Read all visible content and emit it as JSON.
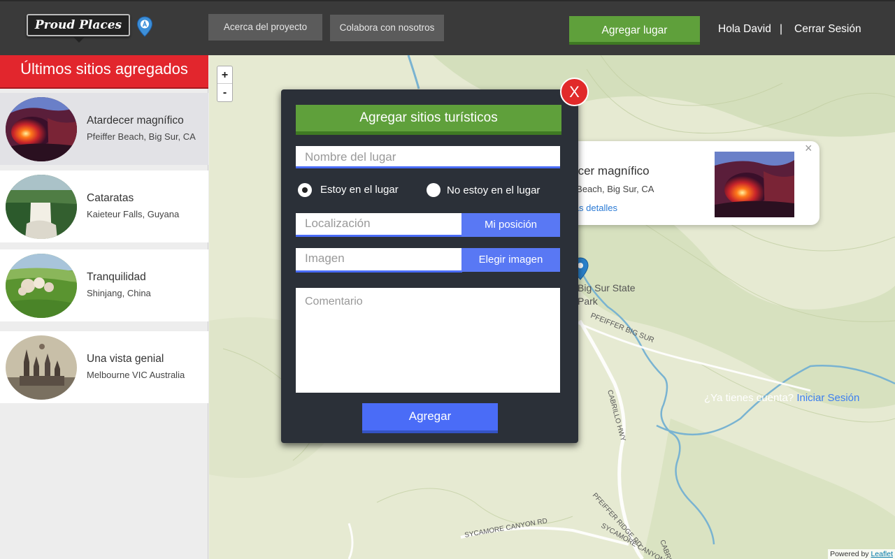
{
  "header": {
    "logo_text": "Proud Places",
    "nav_about": "Acerca del proyecto",
    "nav_collab": "Colabora con nosotros",
    "add_place": "Agregar lugar",
    "greeting": "Hola David",
    "separator": "|",
    "logout": "Cerrar Sesión"
  },
  "sidebar": {
    "title": "Últimos sitios agregados",
    "sites": [
      {
        "name": "Atardecer magnífico",
        "location": "Pfeiffer Beach, Big Sur, CA"
      },
      {
        "name": "Cataratas",
        "location": "Kaieteur Falls, Guyana"
      },
      {
        "name": "Tranquilidad",
        "location": "Shinjang, China"
      },
      {
        "name": "Una vista genial",
        "location": "Melbourne VIC Australia"
      }
    ]
  },
  "map": {
    "zoom_in": "+",
    "zoom_out": "-",
    "labels": {
      "park1": "Big Sur State",
      "park2": "Park",
      "road_pfeiffer_big_sur": "PFEIFFER BIG SUR",
      "road_cabrillo": "CABRILLO HWY",
      "road_pfeiffer_ridge": "PFEIFFER RIDGE RD",
      "road_sycamore1": "SYCAMORE CANYON RD",
      "road_sycamore2": "SYCAMORE CANYON RD",
      "road_cabrillo2": "CABRILLO"
    },
    "popup": {
      "title": "rdecer magnífico",
      "location": "ffer Beach, Big Sur, CA",
      "more": "más detalles",
      "close": "×"
    },
    "login_prompt": "¿Ya tienes cuenta?",
    "login_link": "Iniciar Sesión",
    "attribution_prefix": "Powered by",
    "attribution_link": "Leaflet"
  },
  "modal": {
    "close": "X",
    "title": "Agregar sitios turísticos",
    "name_placeholder": "Nombre del lugar",
    "radio_here": "Estoy en el lugar",
    "radio_not_here": "No estoy en el lugar",
    "location_placeholder": "Localización",
    "my_position": "Mi posición",
    "image_placeholder": "Imagen",
    "choose_image": "Elegir imagen",
    "comment_placeholder": "Comentario",
    "submit": "Agregar"
  },
  "colors": {
    "header_bg": "#3a3a3a",
    "accent_green": "#5fa03b",
    "accent_red": "#e2262d",
    "accent_blue": "#4a6cf7",
    "modal_bg": "#2b3038"
  }
}
